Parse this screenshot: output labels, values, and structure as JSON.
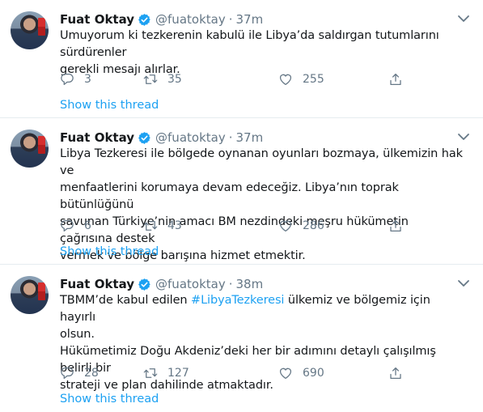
{
  "tweets": [
    {
      "name": "Fuat Oktay",
      "handle": "@fuatoktay",
      "separator": "·",
      "time": "37m",
      "lines": [
        "Umuyorum ki tezkerenin kabulü ile Libya’da saldırgan tutumlarını sürdürenler",
        "gerekli mesajı alırlar."
      ],
      "replies": "3",
      "retweets": "35",
      "likes": "255",
      "show_thread": "Show this thread"
    },
    {
      "name": "Fuat Oktay",
      "handle": "@fuatoktay",
      "separator": "·",
      "time": "37m",
      "lines": [
        "Libya Tezkeresi ile bölgede oynanan oyunları bozmaya, ülkemizin hak ve",
        "menfaatlerini korumaya devam edeceğiz. Libya’nın toprak bütünlüğünü",
        "savunan Türkiye’nin amacı BM nezdindeki meşru hükümetin çağrısına destek",
        "vermek ve bölge barışına hizmet etmektir."
      ],
      "replies": "6",
      "retweets": "43",
      "likes": "286",
      "show_thread": "Show this thread"
    },
    {
      "name": "Fuat Oktay",
      "handle": "@fuatoktay",
      "separator": "·",
      "time": "38m",
      "line1_before": "TBMM’de kabul edilen ",
      "hashtag": "#LibyaTezkeresi",
      "line1_after": " ülkemiz ve bölgemiz için hayırlı",
      "lines": [
        "olsun.",
        "Hükümetimiz Doğu Akdeniz’deki her bir adımını detaylı çalışılmış belirli bir",
        "strateji ve plan dahilinde atmaktadır."
      ],
      "replies": "28",
      "retweets": "127",
      "likes": "690",
      "show_thread": "Show this thread"
    }
  ],
  "colors": {
    "accent": "#1da1f2",
    "muted": "#657786",
    "text": "#14171a",
    "divider": "#e6ecf0"
  },
  "icons": [
    "verified-badge-icon",
    "chevron-down-icon",
    "reply-icon",
    "retweet-icon",
    "like-icon",
    "share-icon"
  ]
}
